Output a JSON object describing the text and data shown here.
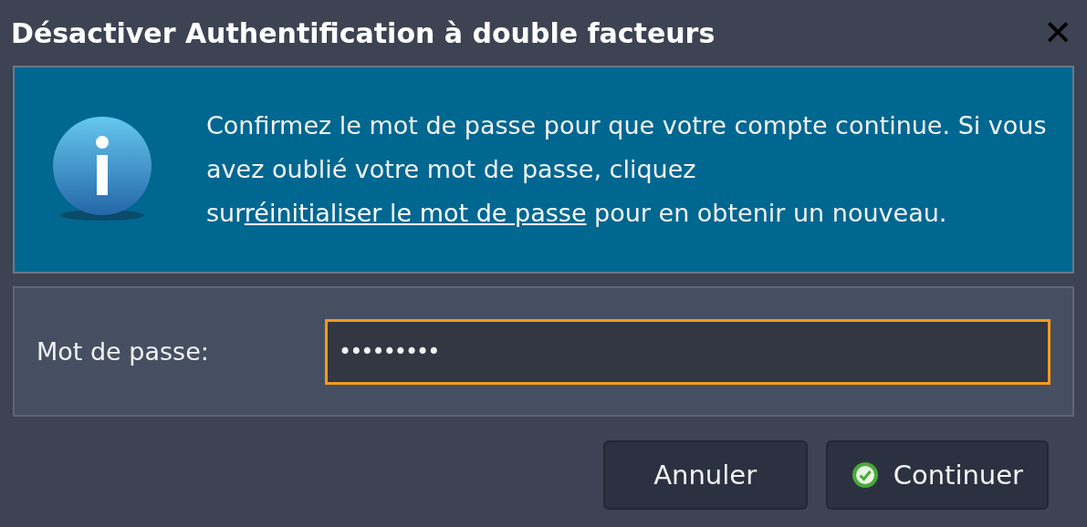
{
  "window": {
    "title": "Désactiver Authentification à double facteurs",
    "close": "✕"
  },
  "info": {
    "before": "Confirmez le mot de passe pour que votre compte continue. Si vous avez oublié votre mot de passe, cliquez sur",
    "link": "réinitialiser le mot de passe",
    "after": " pour en obtenir un nouveau."
  },
  "password": {
    "label": "Mot de passe:",
    "value": "•••••••••",
    "focused": true
  },
  "buttons": [
    {
      "label": "Annuler",
      "kind": "plain"
    },
    {
      "label": "Continuer",
      "kind": "confirm"
    }
  ]
}
